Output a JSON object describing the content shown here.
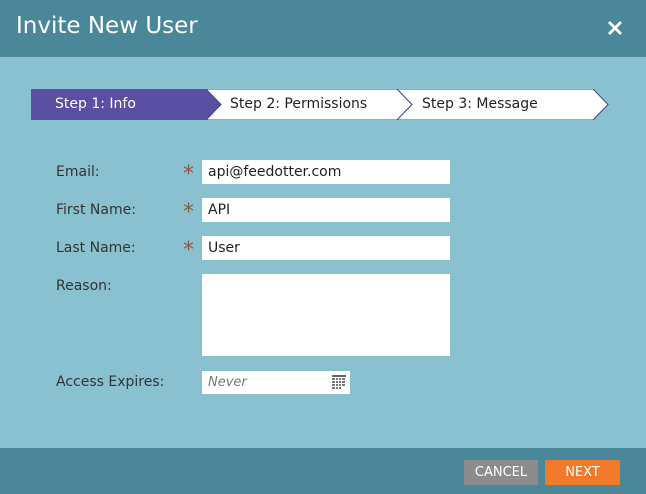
{
  "dialog": {
    "title": "Invite New User"
  },
  "steps": [
    {
      "label": "Step 1: Info",
      "active": true
    },
    {
      "label": "Step 2: Permissions",
      "active": false
    },
    {
      "label": "Step 3: Message",
      "active": false
    }
  ],
  "form": {
    "email": {
      "label": "Email:",
      "value": "api@feedotter.com",
      "required": true
    },
    "first_name": {
      "label": "First Name:",
      "value": "API",
      "required": true
    },
    "last_name": {
      "label": "Last Name:",
      "value": "User",
      "required": true
    },
    "reason": {
      "label": "Reason:",
      "value": ""
    },
    "access_expires": {
      "label": "Access Expires:",
      "placeholder": "Never"
    },
    "required_marker": "*"
  },
  "footer": {
    "cancel_label": "CANCEL",
    "next_label": "NEXT"
  },
  "colors": {
    "header": "#4a8799",
    "body": "#89c1d0",
    "active_step": "#5b4fa3",
    "next_button": "#f07a2a",
    "cancel_button": "#8c8c8c"
  },
  "icons": {
    "close": "close-icon",
    "calendar": "calendar-icon"
  }
}
